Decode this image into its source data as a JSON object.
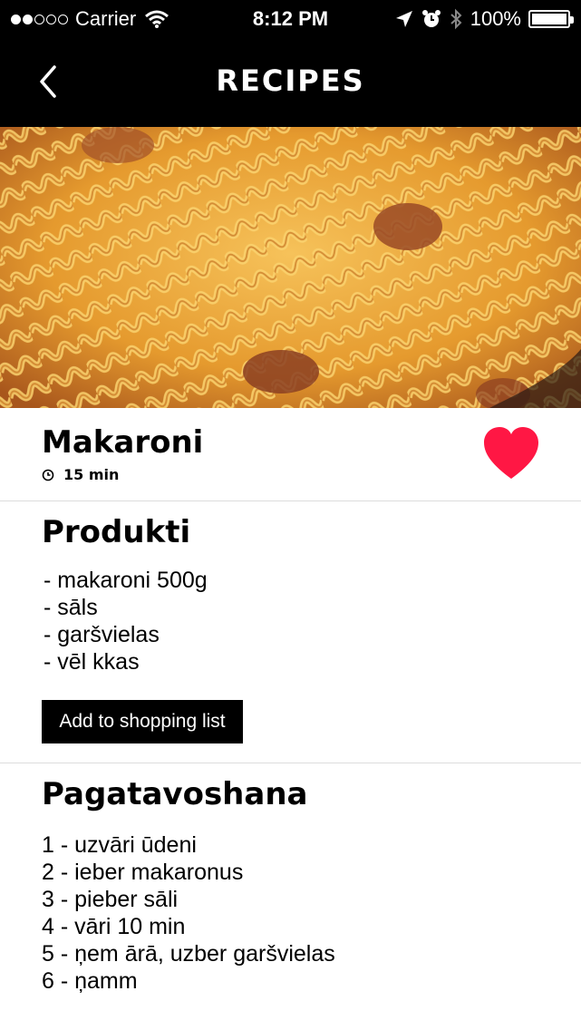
{
  "status_bar": {
    "carrier": "Carrier",
    "time": "8:12 PM",
    "battery": "100%",
    "signal_bars": 2,
    "icons": [
      "wifi-icon",
      "location-arrow-icon",
      "alarm-icon",
      "bluetooth-icon",
      "battery-icon"
    ]
  },
  "nav": {
    "title": "RECIPES",
    "back_icon": "chevron-left-icon"
  },
  "recipe": {
    "title": "Makaroni",
    "time": "15 min",
    "favorite": true,
    "favorite_color": "#ff1744"
  },
  "products": {
    "title": "Produkti",
    "items": [
      "- makaroni 500g",
      "- sāls",
      "- garšvielas",
      "- vēl kkas"
    ],
    "button_label": "Add to shopping list"
  },
  "preparation": {
    "title": "Pagatavoshana",
    "steps": [
      "1 - uzvāri ūdeni",
      "2 - ieber makaronus",
      "3 - pieber sāli",
      "4 - vāri 10 min",
      "5 - ņem ārā, uzber garšvielas",
      "6 - ņamm"
    ]
  },
  "colors": {
    "header_bg": "#000000",
    "heart": "#ff1744",
    "divider": "#dddddd"
  }
}
